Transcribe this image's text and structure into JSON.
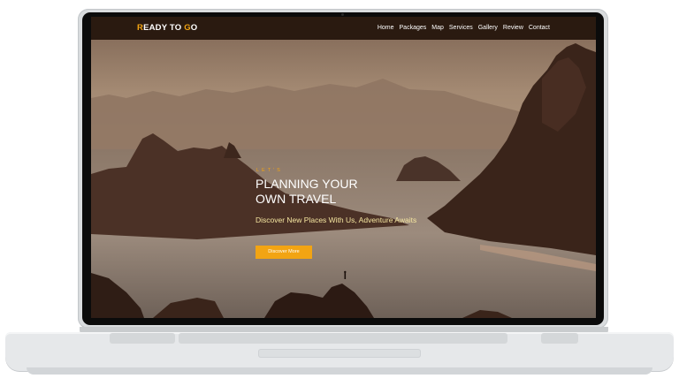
{
  "site": {
    "brand": {
      "accent_letter": "R",
      "mid": "EADY TO ",
      "accent_letter2": "G",
      "rest": "O"
    },
    "nav": [
      {
        "label": "Home"
      },
      {
        "label": "Packages"
      },
      {
        "label": "Map"
      },
      {
        "label": "Services"
      },
      {
        "label": "Gallery"
      },
      {
        "label": "Review"
      },
      {
        "label": "Contact"
      }
    ],
    "hero": {
      "eyebrow": "LET'S",
      "headline_line1": "PLANNING YOUR",
      "headline_line2": "OWN TRAVEL",
      "tagline": "Discover New Places With Us, Adventure Awaits",
      "cta_label": "Discover More"
    }
  },
  "colors": {
    "accent": "#f2a413",
    "navbar": "#2a1a10",
    "tagline": "#f5e6a0",
    "device_frame": "#d9dcde"
  }
}
